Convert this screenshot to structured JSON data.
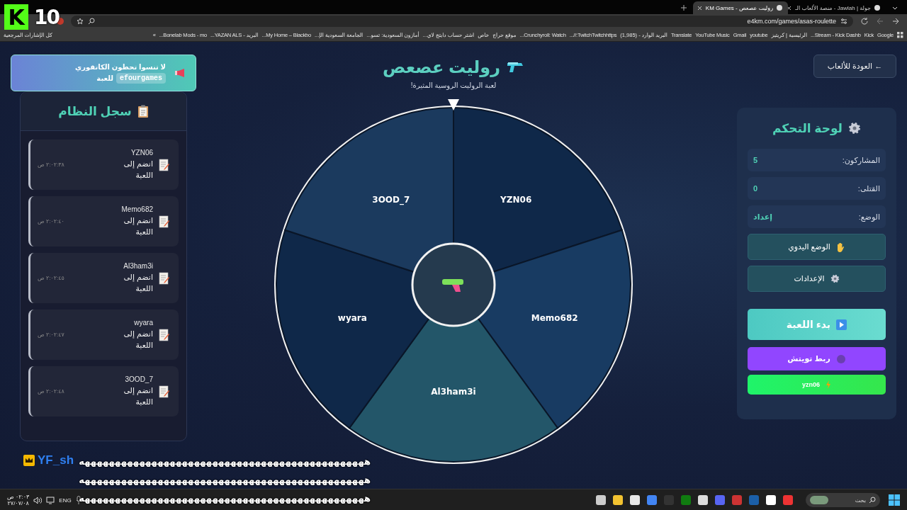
{
  "overlay": {
    "logo_letter": "K",
    "viewer_count": "10"
  },
  "browser": {
    "tabs": [
      {
        "title": "جولة | Jawlah - منصة الألعاب الـ",
        "selected": false
      },
      {
        "title": "روليت عصعص - KM Games",
        "selected": true
      }
    ],
    "url": "e4km.com/games/asas-roulette",
    "bookmarks": [
      "Google",
      "Kick",
      "Stream - Kick Dashb...",
      "الرئيسية | كريتيز",
      "youtube",
      "Gmail",
      "YouTube Music",
      "Translate",
      "البريد الوارد - (1,985)",
      "TwitchTwitchhttps://...",
      "Crunchyroll: Watch...",
      "موقع حراج",
      "خاص",
      "اشتر حساب دايتج لاي...",
      "أمازون السعودية: تسو...",
      "الجامعة السعودية الإ...",
      "My Home – Blackbo...",
      "البريد - YAZAN ALS...",
      "Bonelab Mods - mo..."
    ],
    "more": "»",
    "all_bookmarks": "كل الإشارات المرجعية"
  },
  "announcement": {
    "text": "لا تنسوا تحطون الكاتقوري",
    "code": "efourgames",
    "suffix": "للعبة"
  },
  "log": {
    "title": "سجل النظام",
    "entries": [
      {
        "player": "YZN06",
        "message": "انضم إلى اللعبة",
        "time": "٢:٠٢:٣٨ ص"
      },
      {
        "player": "Memo682",
        "message": "انضم إلى اللعبة",
        "time": "٢:٠٢:٤٠ ص"
      },
      {
        "player": "Al3ham3i",
        "message": "انضم إلى اللعبة",
        "time": "٢:٠٢:٤٥ ص"
      },
      {
        "player": "wyara",
        "message": "انضم إلى اللعبة",
        "time": "٢:٠٢:٤٧ ص"
      },
      {
        "player": "3OOD_7",
        "message": "انضم إلى اللعبة",
        "time": "٢:٠٢:٤٨ ص"
      }
    ]
  },
  "game": {
    "title": "روليت عصعص",
    "subtitle": "لعبة الروليت الروسية المثيرة!",
    "slices": [
      {
        "name": "YZN06",
        "color": "#0f2849"
      },
      {
        "name": "Memo682",
        "color": "#183b62"
      },
      {
        "name": "Al3ham3i",
        "color": "#235669"
      },
      {
        "name": "wyara",
        "color": "#0f2849"
      },
      {
        "name": "3OOD_7",
        "color": "#1b3a5e"
      }
    ]
  },
  "back_button": "← العودة للألعاب",
  "controls": {
    "title": "لوحة التحكم",
    "stats": [
      {
        "label": "المشاركون:",
        "value": "5"
      },
      {
        "label": "القتلى:",
        "value": "0"
      },
      {
        "label": "الوضع:",
        "value": "إعداد"
      }
    ],
    "buttons": [
      {
        "kind": "secondary",
        "label": "الوضع اليدوي"
      },
      {
        "kind": "secondary",
        "label": "الإعدادات"
      },
      {
        "kind": "primary",
        "label": "بدء اللعبة"
      },
      {
        "kind": "twitch",
        "label": "ربط تويتش"
      },
      {
        "kind": "kick",
        "label": "yzn06"
      }
    ]
  },
  "chat": {
    "user": "YF_sh",
    "lines": [
      "هههههههههههههههههههههههههههههههههههههههههههههههه",
      "هههههههههههههههههههههههههههههههههههههههههههههههه",
      "هههههههههههههههههههههههههههههههههههههههههههههههه"
    ]
  },
  "taskbar": {
    "search_placeholder": "بحث",
    "language": "ENG",
    "time": "٠٢:٠٣ ص",
    "date": "٢٧/٠٧/٠٨"
  }
}
